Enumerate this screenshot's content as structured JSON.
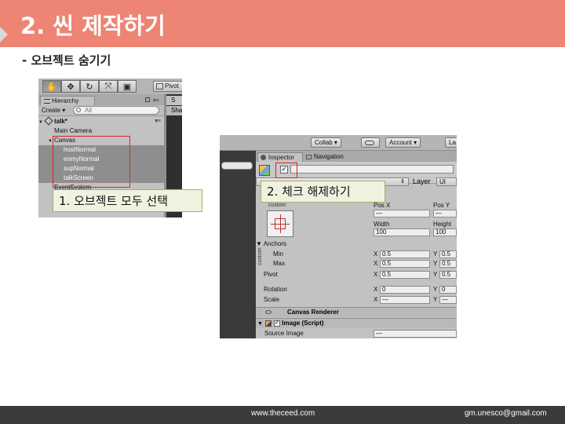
{
  "slide": {
    "title": "2. 씬 제작하기",
    "subtitle": "- 오브젝트 숨기기",
    "footer_web": "www.theceed.com",
    "footer_email": "gm.unesco@gmail.com",
    "accent_color": "#ee8473"
  },
  "hierarchy_shot": {
    "pivot_label": "Pivot",
    "tab_label": "Hierarchy",
    "scene_tab_label": "S",
    "scene_sha_label": "Sha",
    "create_label": "Create ▾",
    "search_placeholder": "All",
    "tools": [
      "hand-icon",
      "move-icon",
      "rotate-icon",
      "scale-icon",
      "rect-tool-icon"
    ],
    "tool_glyphs": [
      "✋",
      "✥",
      "↻",
      "⤧",
      "▣"
    ],
    "scene_name": "talk*",
    "items": [
      {
        "label": "Main Camera"
      },
      {
        "label": "Canvas"
      },
      {
        "label": "hostNormal"
      },
      {
        "label": "enmyNormal"
      },
      {
        "label": "supNormal"
      },
      {
        "label": "talkScreen"
      },
      {
        "label": "EventSystem"
      }
    ]
  },
  "inspector_shot": {
    "collab_label": "Collab ▾",
    "account_label": "Account ▾",
    "layout_label": "La",
    "inspector_tab": "Inspector",
    "navigation_tab": "Navigation",
    "layer_label": "Layer",
    "layer_value": "UI",
    "custom_label": "custom",
    "pos_x_label": "Pos X",
    "pos_y_label": "Pos Y",
    "pos_x_value": "—",
    "pos_y_value": "—",
    "width_label": "Width",
    "height_label": "Height",
    "width_value": "100",
    "height_value": "100",
    "anchors_label": "Anchors",
    "min_label": "Min",
    "max_label": "Max",
    "pivot_label": "Pivot",
    "rotation_label": "Rotation",
    "scale_label": "Scale",
    "min_x": "0.5",
    "min_y": "0.5",
    "max_x": "0.5",
    "max_y": "0.5",
    "pivot_x": "0.5",
    "pivot_y": "0.5",
    "rot_x": "0",
    "rot_y": "0",
    "scale_x": "—",
    "scale_y": "—",
    "x_axis": "X",
    "y_axis": "Y",
    "canvas_renderer": "Canvas Renderer",
    "image_script": "Image (Script)",
    "source_image_label": "Source Image",
    "source_image_value": "—"
  },
  "callouts": {
    "step1": "1. 오브젝트 모두 선택",
    "step2": "2. 체크 해제하기"
  }
}
